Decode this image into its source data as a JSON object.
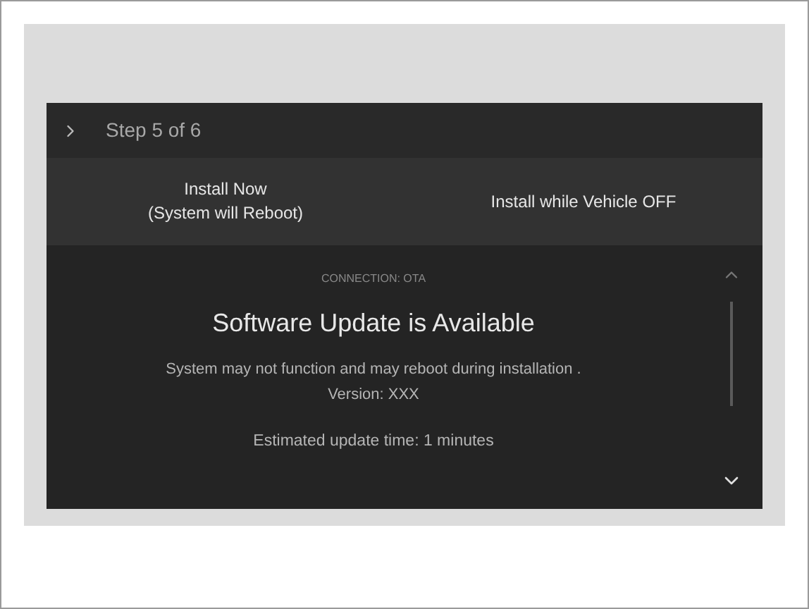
{
  "header": {
    "title": "Step 5 of 6"
  },
  "buttons": [
    {
      "label": "Install Now\n(System will Reboot)"
    },
    {
      "label": "Install while Vehicle OFF"
    }
  ],
  "content": {
    "caption": "CONNECTION: OTA",
    "title": "Software Update is Available",
    "message": "System may not function and may reboot during installation .\nVersion: XXX",
    "estimate": "Estimated update time: 1 minutes"
  }
}
